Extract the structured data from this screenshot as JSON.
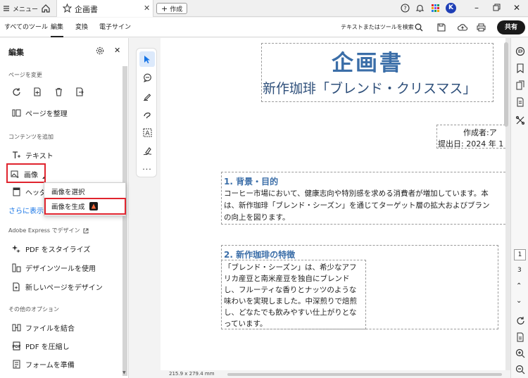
{
  "titlebar": {
    "menu_label": "メニュー",
    "tab_title": "企画書",
    "new_tab_label": "作成",
    "account_initial": "K"
  },
  "toolbar": {
    "menu_items": [
      "すべてのツール",
      "編集",
      "変換",
      "電子サイン"
    ],
    "active_item": "編集",
    "search_label": "テキストまたはツールを検索",
    "share_label": "共有"
  },
  "left_panel": {
    "title": "編集",
    "section_page": "ページを変更",
    "organize_label": "ページを整理",
    "section_content": "コンテンツを追加",
    "text_label": "テキスト",
    "image_label": "画像",
    "header_label": "ヘッダ",
    "more_label": "さらに表示",
    "section_express": "Adobe Express でデザイン",
    "stylize_label": "PDF をスタイライズ",
    "design_tools_label": "デザインツールを使用",
    "new_page_label": "新しいページをデザイン",
    "section_other": "その他のオプション",
    "combine_label": "ファイルを結合",
    "reduce_label": "PDF を圧縮し",
    "form_label": "フォームを準備"
  },
  "popup": {
    "select_image": "画像を選択",
    "generate_image": "画像を生成"
  },
  "document": {
    "title": "企画書",
    "subtitle": "新作珈琲「ブレンド・クリスマス」",
    "author": "作成者:ア",
    "date": "提出日: 2024 年 1",
    "section1_heading": "1.  背景・目的",
    "section1_lines": [
      "コーヒー市場において、健康志向や特別感を求める消費者が増加しています。本",
      "は、新作珈琲「ブレンド・シーズン」を通じてターゲット層の拡大およびブラン",
      "の向上を図ります。"
    ],
    "section2_heading": "2.  新作珈琲の特徴",
    "section2_lines": [
      "「ブレンド・シーズン」は、希少なアフ",
      "リカ産豆と南米産豆を独自にブレンド",
      "し、フルーティな香りとナッツのような",
      "味わいを実現しました。中深煎りで焙煎",
      "し、どなたでも飲みやすい仕上がりとな",
      "っています。"
    ]
  },
  "status": {
    "page_size": "215.9 x 279.4 mm"
  },
  "pager": {
    "current_page": "1",
    "total_pages": "3"
  },
  "colors": {
    "heading_blue": "#3b6ea8",
    "highlight_red": "#e0242e",
    "share_bg": "#1a1a1a",
    "select_blue": "#1473e6"
  }
}
